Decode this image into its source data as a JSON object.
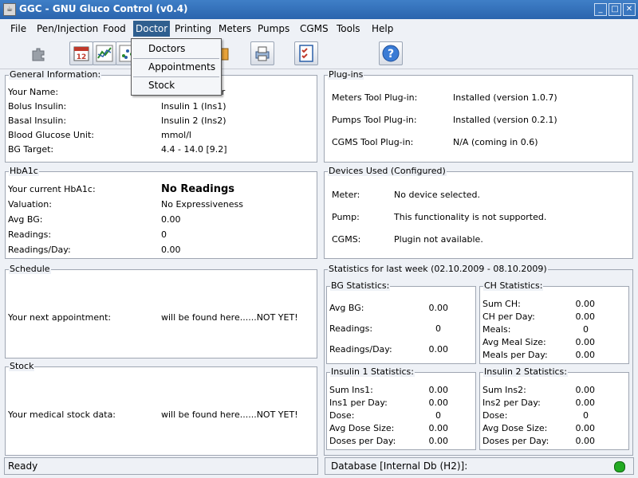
{
  "window": {
    "title": "GGC - GNU Gluco Control (v0.4)",
    "controls": [
      "_",
      "□",
      "✕"
    ]
  },
  "menu": [
    "File",
    "Pen/Injection",
    "Food",
    "Doctor",
    "Printing",
    "Meters",
    "Pumps",
    "CGMS",
    "Tools",
    "Help"
  ],
  "toolbar": {
    "icons": [
      "plugin-icon",
      "calendar-icon",
      "line-graph-icon",
      "scatter-graph-icon",
      "food-icon",
      "printer-icon",
      "checklist-icon",
      "help-icon"
    ],
    "calendar_day": "12"
  },
  "doctor_menu": [
    "Doctors",
    "Appointments",
    "Stock"
  ],
  "general": {
    "title": "General Information:",
    "rows": [
      {
        "label": "Your Name:",
        "value": "or"
      },
      {
        "label": "Bolus Insulin:",
        "value": "Insulin 1  (Ins1)"
      },
      {
        "label": "Basal Insulin:",
        "value": "Insulin 2  (Ins2)"
      },
      {
        "label": "Blood Glucose Unit:",
        "value": "mmol/l"
      },
      {
        "label": "BG Target:",
        "value": "4.4 - 14.0 [9.2]"
      }
    ]
  },
  "plugins": {
    "title": "Plug-ins",
    "rows": [
      {
        "label": "Meters Tool Plug-in:",
        "value": "Installed (version 1.0.7)"
      },
      {
        "label": "Pumps Tool Plug-in:",
        "value": "Installed (version 0.2.1)"
      },
      {
        "label": "CGMS Tool Plug-in:",
        "value": "N/A (coming in 0.6)"
      }
    ]
  },
  "hba1c": {
    "title": "HbA1c",
    "rows": [
      {
        "label": "Your current HbA1c:",
        "value": "No Readings"
      },
      {
        "label": "Valuation:",
        "value": "No Expressiveness"
      },
      {
        "label": "Avg BG:",
        "value": "0.00"
      },
      {
        "label": "Readings:",
        "value": "0"
      },
      {
        "label": "Readings/Day:",
        "value": "0.00"
      }
    ]
  },
  "devices": {
    "title": "Devices Used (Configured)",
    "rows": [
      {
        "label": "Meter:",
        "value": "No device selected."
      },
      {
        "label": "Pump:",
        "value": "This functionality is not supported."
      },
      {
        "label": "CGMS:",
        "value": "Plugin not available."
      }
    ]
  },
  "schedule": {
    "title": "Schedule",
    "label": "Your next appointment:",
    "value": "will be found here......NOT YET!"
  },
  "stock": {
    "title": "Stock",
    "label": "Your medical stock data:",
    "value": "will be found here......NOT YET!"
  },
  "stats": {
    "title": "Statistics for last week (02.10.2009 - 08.10.2009)",
    "bg": {
      "title": "BG Statistics:",
      "rows": [
        {
          "label": "Avg BG:",
          "value": "0.00"
        },
        {
          "label": "Readings:",
          "value": "0"
        },
        {
          "label": "Readings/Day:",
          "value": "0.00"
        }
      ]
    },
    "ch": {
      "title": "CH Statistics:",
      "rows": [
        {
          "label": "Sum CH:",
          "value": "0.00"
        },
        {
          "label": "CH per Day:",
          "value": "0.00"
        },
        {
          "label": "Meals:",
          "value": "0"
        },
        {
          "label": "Avg Meal Size:",
          "value": "0.00"
        },
        {
          "label": "Meals per Day:",
          "value": "0.00"
        }
      ]
    },
    "ins1": {
      "title": "Insulin 1 Statistics:",
      "rows": [
        {
          "label": "Sum Ins1:",
          "value": "0.00"
        },
        {
          "label": "Ins1 per Day:",
          "value": "0.00"
        },
        {
          "label": "Dose:",
          "value": "0"
        },
        {
          "label": "Avg Dose Size:",
          "value": "0.00"
        },
        {
          "label": "Doses per Day:",
          "value": "0.00"
        }
      ]
    },
    "ins2": {
      "title": "Insulin 2 Statistics:",
      "rows": [
        {
          "label": "Sum Ins2:",
          "value": "0.00"
        },
        {
          "label": "Ins2 per Day:",
          "value": "0.00"
        },
        {
          "label": "Dose:",
          "value": "0"
        },
        {
          "label": "Avg Dose Size:",
          "value": "0.00"
        },
        {
          "label": "Doses per Day:",
          "value": "0.00"
        }
      ]
    }
  },
  "status": {
    "left": "Ready",
    "right": "Database [Internal Db (H2)]:",
    "indicator_color": "#22aa22"
  }
}
